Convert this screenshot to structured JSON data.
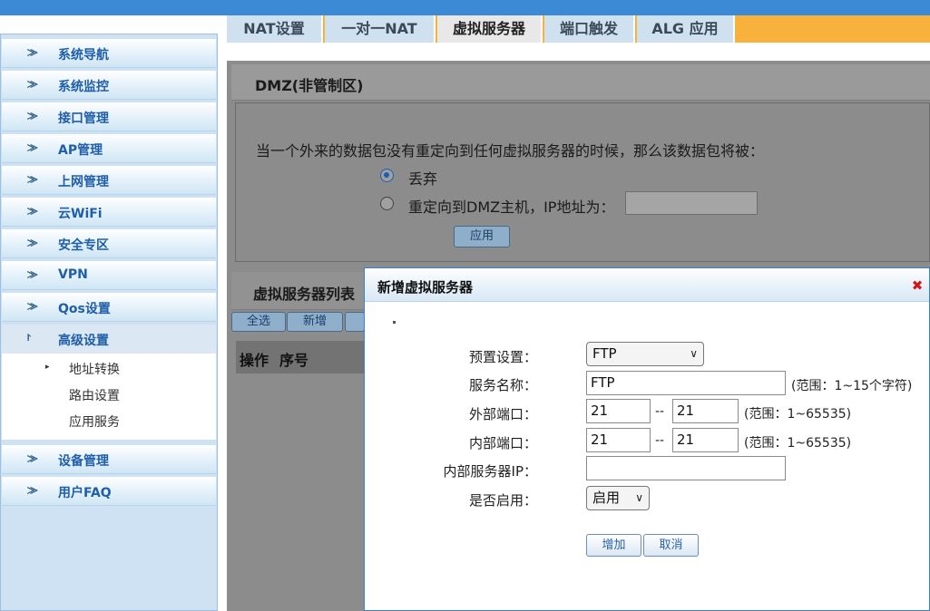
{
  "sidebar": {
    "items": [
      {
        "label": "系统导航"
      },
      {
        "label": "系统监控"
      },
      {
        "label": "接口管理"
      },
      {
        "label": "AP管理"
      },
      {
        "label": "上网管理"
      },
      {
        "label": "云WiFi"
      },
      {
        "label": "安全专区"
      },
      {
        "label": "VPN"
      },
      {
        "label": "Qos设置"
      },
      {
        "label": "高级设置"
      },
      {
        "label": "设备管理"
      },
      {
        "label": "用户FAQ"
      }
    ],
    "sub_items": [
      {
        "label": "地址转换"
      },
      {
        "label": "路由设置"
      },
      {
        "label": "应用服务"
      }
    ]
  },
  "tabs": [
    {
      "label": "NAT设置"
    },
    {
      "label": "一对一NAT"
    },
    {
      "label": "虚拟服务器"
    },
    {
      "label": "端口触发"
    },
    {
      "label": "ALG 应用"
    }
  ],
  "dmz": {
    "title": "DMZ(非管制区)",
    "description": "当一个外来的数据包没有重定向到任何虚拟服务器的时候，那么该数据包将被：",
    "option_drop": "丢弃",
    "option_redirect": "重定向到DMZ主机，IP地址为：",
    "apply_label": "应用"
  },
  "vs_list": {
    "title": "虚拟服务器列表",
    "select_all": "全选",
    "add": "新增",
    "col_action": "操作",
    "col_index": "序号"
  },
  "dialog": {
    "title": "新增虚拟服务器",
    "preset_label": "预置设置：",
    "preset_value": "FTP",
    "service_name_label": "服务名称：",
    "service_name_value": "FTP",
    "service_name_hint": "(范围：1~15个字符)",
    "ext_port_label": "外部端口：",
    "ext_port_start": "21",
    "ext_port_end": "21",
    "int_port_label": "内部端口：",
    "int_port_start": "21",
    "int_port_end": "21",
    "port_hint": "(范围：1~65535)",
    "range_sep": "--",
    "server_ip_label": "内部服务器IP：",
    "server_ip_value": "",
    "enable_label": "是否启用：",
    "enable_value": "启用",
    "add_button": "增加",
    "cancel_button": "取消"
  }
}
